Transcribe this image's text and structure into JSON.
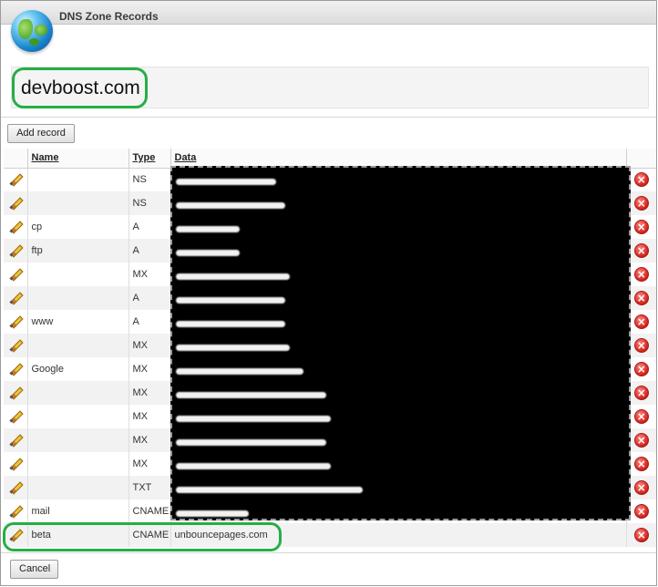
{
  "window": {
    "title": "DNS Zone Records"
  },
  "zone": {
    "domain": "devboost.com"
  },
  "toolbar": {
    "add_label": "Add record"
  },
  "footer": {
    "cancel_label": "Cancel"
  },
  "table": {
    "columns": {
      "name": "Name",
      "type": "Type",
      "data": "Data"
    },
    "rows": [
      {
        "name": "",
        "type": "NS",
        "data": ""
      },
      {
        "name": "",
        "type": "NS",
        "data": ""
      },
      {
        "name": "cp",
        "type": "A",
        "data": ""
      },
      {
        "name": "ftp",
        "type": "A",
        "data": ""
      },
      {
        "name": "",
        "type": "MX",
        "data": ""
      },
      {
        "name": "",
        "type": "A",
        "data": ""
      },
      {
        "name": "www",
        "type": "A",
        "data": ""
      },
      {
        "name": "",
        "type": "MX",
        "data": ""
      },
      {
        "name": "Google",
        "type": "MX",
        "data": ""
      },
      {
        "name": "",
        "type": "MX",
        "data": ""
      },
      {
        "name": "",
        "type": "MX",
        "data": ""
      },
      {
        "name": "",
        "type": "MX",
        "data": ""
      },
      {
        "name": "",
        "type": "MX",
        "data": ""
      },
      {
        "name": "",
        "type": "TXT",
        "data": ""
      },
      {
        "name": "mail",
        "type": "CNAME",
        "data": ""
      },
      {
        "name": "beta",
        "type": "CNAME",
        "data": "unbouncepages.com"
      }
    ]
  },
  "icons": {
    "edit": "pencil-icon",
    "delete": "delete-icon",
    "logo": "globe-icon"
  },
  "colors": {
    "highlight": "#25ae46",
    "delete": "#d4261f"
  }
}
